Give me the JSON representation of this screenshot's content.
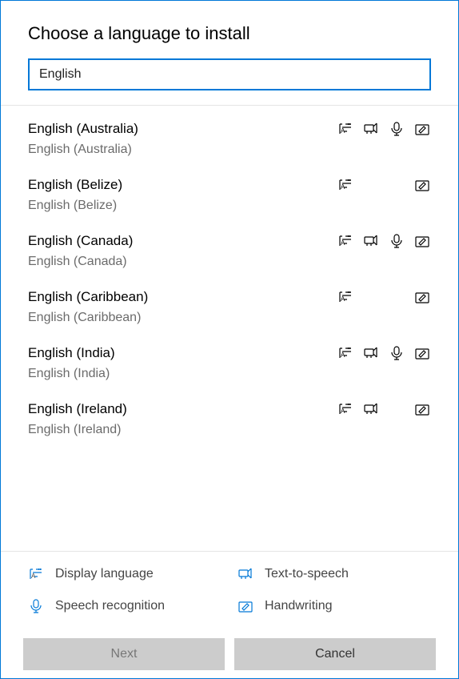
{
  "title": "Choose a language to install",
  "search": {
    "value": "English"
  },
  "languages": [
    {
      "name": "English (Australia)",
      "native": "English (Australia)",
      "display": true,
      "tts": true,
      "speech": true,
      "hand": true
    },
    {
      "name": "English (Belize)",
      "native": "English (Belize)",
      "display": true,
      "tts": false,
      "speech": false,
      "hand": true
    },
    {
      "name": "English (Canada)",
      "native": "English (Canada)",
      "display": true,
      "tts": true,
      "speech": true,
      "hand": true
    },
    {
      "name": "English (Caribbean)",
      "native": "English (Caribbean)",
      "display": true,
      "tts": false,
      "speech": false,
      "hand": true
    },
    {
      "name": "English (India)",
      "native": "English (India)",
      "display": true,
      "tts": true,
      "speech": true,
      "hand": true
    },
    {
      "name": "English (Ireland)",
      "native": "English (Ireland)",
      "display": true,
      "tts": true,
      "speech": false,
      "hand": true
    }
  ],
  "legend": {
    "display": "Display language",
    "tts": "Text-to-speech",
    "speech": "Speech recognition",
    "hand": "Handwriting"
  },
  "buttons": {
    "next": "Next",
    "cancel": "Cancel"
  }
}
